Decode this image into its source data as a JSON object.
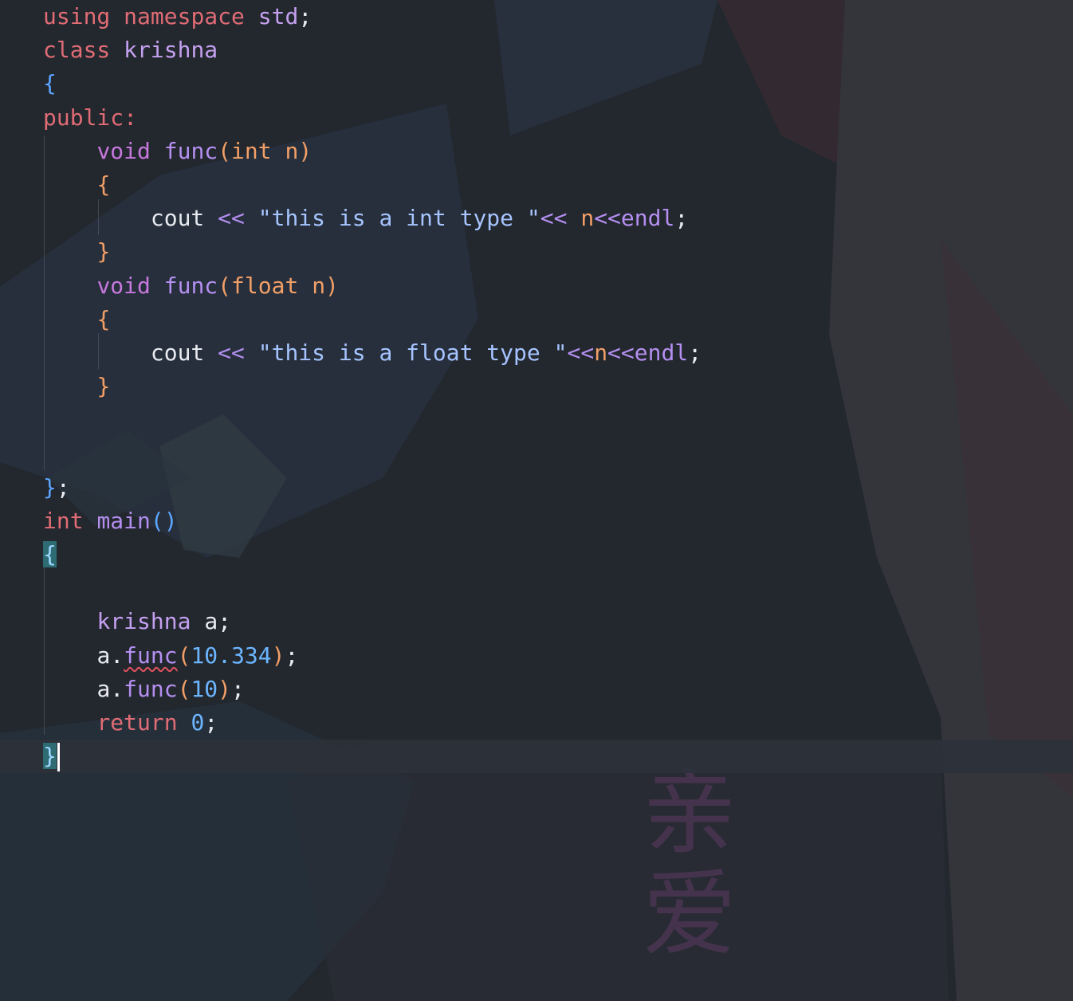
{
  "editor": {
    "language": "C++",
    "lines": [
      {
        "tokens": [
          [
            "kw",
            "using"
          ],
          [
            "id",
            " "
          ],
          [
            "kw",
            "namespace"
          ],
          [
            "id",
            " "
          ],
          [
            "std",
            "std"
          ],
          [
            "id",
            ";"
          ]
        ]
      },
      {
        "tokens": [
          [
            "kw",
            "class"
          ],
          [
            "id",
            " "
          ],
          [
            "cls",
            "krishna"
          ]
        ]
      },
      {
        "tokens": [
          [
            "brace-b",
            "{"
          ]
        ]
      },
      {
        "tokens": [
          [
            "kw",
            "public"
          ],
          [
            "kw",
            ":"
          ]
        ]
      },
      {
        "tokens": [
          [
            "id",
            "    "
          ],
          [
            "kw2",
            "void"
          ],
          [
            "id",
            " "
          ],
          [
            "fn",
            "func"
          ],
          [
            "orange",
            "("
          ],
          [
            "orange",
            "int"
          ],
          [
            "id",
            " "
          ],
          [
            "orange",
            "n"
          ],
          [
            "orange",
            ")"
          ]
        ]
      },
      {
        "tokens": [
          [
            "id",
            "    "
          ],
          [
            "brace-o",
            "{"
          ]
        ]
      },
      {
        "tokens": [
          [
            "id",
            "        "
          ],
          [
            "id",
            "cout"
          ],
          [
            "id",
            " "
          ],
          [
            "op",
            "<<"
          ],
          [
            "id",
            " "
          ],
          [
            "str",
            "\"this is a int type \""
          ],
          [
            "op",
            "<<"
          ],
          [
            "id",
            " "
          ],
          [
            "orange",
            "n"
          ],
          [
            "op",
            "<<"
          ],
          [
            "fn",
            "endl"
          ],
          [
            "id",
            ";"
          ]
        ]
      },
      {
        "tokens": [
          [
            "id",
            "    "
          ],
          [
            "brace-o",
            "}"
          ]
        ]
      },
      {
        "tokens": [
          [
            "id",
            "    "
          ],
          [
            "kw2",
            "void"
          ],
          [
            "id",
            " "
          ],
          [
            "fn",
            "func"
          ],
          [
            "orange",
            "("
          ],
          [
            "orange",
            "float"
          ],
          [
            "id",
            " "
          ],
          [
            "orange",
            "n"
          ],
          [
            "orange",
            ")"
          ]
        ]
      },
      {
        "tokens": [
          [
            "id",
            "    "
          ],
          [
            "brace-o",
            "{"
          ]
        ]
      },
      {
        "tokens": [
          [
            "id",
            "        "
          ],
          [
            "id",
            "cout"
          ],
          [
            "id",
            " "
          ],
          [
            "op",
            "<<"
          ],
          [
            "id",
            " "
          ],
          [
            "str",
            "\"this is a float type \""
          ],
          [
            "op",
            "<<"
          ],
          [
            "orange",
            "n"
          ],
          [
            "op",
            "<<"
          ],
          [
            "fn",
            "endl"
          ],
          [
            "id",
            ";"
          ]
        ]
      },
      {
        "tokens": [
          [
            "id",
            "    "
          ],
          [
            "brace-o",
            "}"
          ]
        ]
      },
      {
        "tokens": []
      },
      {
        "tokens": []
      },
      {
        "tokens": [
          [
            "brace-b",
            "}"
          ],
          [
            "id",
            ";"
          ]
        ]
      },
      {
        "tokens": [
          [
            "kw",
            "int"
          ],
          [
            "id",
            " "
          ],
          [
            "fn",
            "main"
          ],
          [
            "brace-b",
            "()"
          ]
        ]
      },
      {
        "tokens": [
          [
            "match",
            "{"
          ]
        ]
      },
      {
        "tokens": []
      },
      {
        "tokens": [
          [
            "id",
            "    "
          ],
          [
            "cls",
            "krishna"
          ],
          [
            "id",
            " "
          ],
          [
            "id",
            "a"
          ],
          [
            "id",
            ";"
          ]
        ]
      },
      {
        "tokens": [
          [
            "id",
            "    "
          ],
          [
            "id",
            "a"
          ],
          [
            "id",
            "."
          ],
          [
            "fn squiggle",
            "func"
          ],
          [
            "brace-o",
            "("
          ],
          [
            "num",
            "10.334"
          ],
          [
            "brace-o",
            ")"
          ],
          [
            "id",
            ";"
          ]
        ]
      },
      {
        "tokens": [
          [
            "id",
            "    "
          ],
          [
            "id",
            "a"
          ],
          [
            "id",
            "."
          ],
          [
            "fn",
            "func"
          ],
          [
            "brace-o",
            "("
          ],
          [
            "num",
            "10"
          ],
          [
            "brace-o",
            ")"
          ],
          [
            "id",
            ";"
          ]
        ]
      },
      {
        "tokens": [
          [
            "id",
            "    "
          ],
          [
            "kw",
            "return"
          ],
          [
            "id",
            " "
          ],
          [
            "num",
            "0"
          ],
          [
            "id",
            ";"
          ]
        ]
      },
      {
        "tokens": [
          [
            "match",
            "}"
          ]
        ],
        "current": true,
        "caret": true
      }
    ]
  },
  "watermark": {
    "text": "亲爱"
  },
  "colors": {
    "background": "#23272e",
    "keyword": "#e06c75",
    "type_keyword": "#c678dd",
    "function": "#b48ff0",
    "string": "#a6c4ff",
    "number": "#6cb6ff",
    "parameter": "#f29f67",
    "error_squiggle": "#e0525e"
  }
}
